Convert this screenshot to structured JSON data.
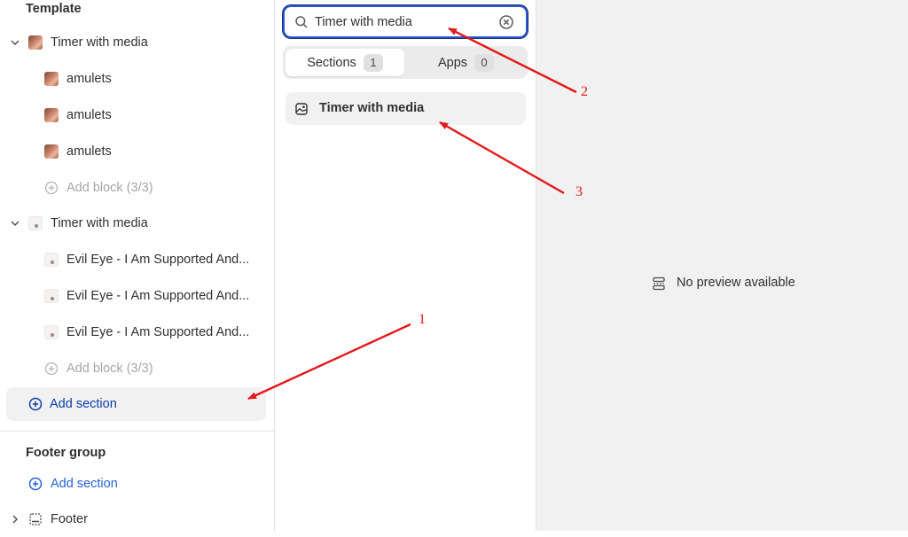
{
  "template_group": {
    "title": "Template",
    "sections": [
      {
        "label": "Timer with media",
        "blocks": [
          "amulets",
          "amulets",
          "amulets"
        ],
        "add_block_label": "Add block (3/3)"
      },
      {
        "label": "Timer with media",
        "blocks": [
          "Evil Eye - I Am Supported And...",
          "Evil Eye - I Am Supported And...",
          "Evil Eye - I Am Supported And..."
        ],
        "add_block_label": "Add block (3/3)"
      }
    ],
    "add_section_label": "Add section"
  },
  "footer_group": {
    "title": "Footer group",
    "add_section_label": "Add section",
    "footer_label": "Footer"
  },
  "search": {
    "value": "Timer with media"
  },
  "tabs": [
    {
      "label": "Sections",
      "count": "1"
    },
    {
      "label": "Apps",
      "count": "0"
    }
  ],
  "results": [
    {
      "label": "Timer with media"
    }
  ],
  "preview": {
    "message": "No preview available"
  },
  "annotations": [
    "1",
    "2",
    "3"
  ],
  "colors": {
    "accent_blue": "#2463d6",
    "annotation_red": "#e3191c",
    "panel_gray": "#f1f1f1"
  }
}
